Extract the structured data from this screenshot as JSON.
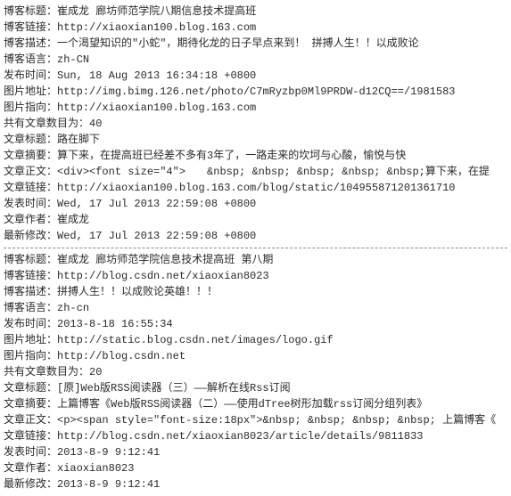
{
  "blocks": [
    {
      "fields": [
        {
          "label": "博客标题：",
          "value": "崔成龙 廊坊师范学院八期信息技术提高班"
        },
        {
          "label": "博客链接：",
          "value": "http://xiaoxian100.blog.163.com"
        },
        {
          "label": "博客描述：",
          "value": "一个渴望知识的\"小蛇\"，期待化龙的日子早点来到！ 拼搏人生！！以成败论"
        },
        {
          "label": "博客语言：",
          "value": "zh-CN"
        },
        {
          "label": "发布时间：",
          "value": "Sun, 18 Aug 2013 16:34:18 +0800"
        },
        {
          "label": "图片地址：",
          "value": "http://img.bimg.126.net/photo/C7mRyzbp0Ml9PRDW-d12CQ==/1981583"
        },
        {
          "label": "图片指向：",
          "value": "http://xiaoxian100.blog.163.com"
        },
        {
          "label": "共有文章数目为：",
          "value": "40"
        },
        {
          "label": "文章标题：",
          "value": "路在脚下"
        },
        {
          "label": "文章摘要：",
          "value": "算下来，在提高班已经差不多有3年了，一路走来的坎坷与心酸，愉悦与快"
        },
        {
          "label": "文章正文：",
          "value": "<div><font size=\"4\">　　&nbsp; &nbsp; &nbsp; &nbsp; &nbsp;算下来，在提"
        },
        {
          "label": "文章链接：",
          "value": "http://xiaoxian100.blog.163.com/blog/static/104955871201361710"
        },
        {
          "label": "发表时间：",
          "value": "Wed, 17 Jul 2013 22:59:08 +0800"
        },
        {
          "label": "文章作者：",
          "value": "崔成龙"
        },
        {
          "label": "最新修改：",
          "value": "Wed, 17 Jul 2013 22:59:08 +0800"
        }
      ]
    },
    {
      "fields": [
        {
          "label": "博客标题：",
          "value": "崔成龙 廊坊师范学院信息技术提高班 第八期"
        },
        {
          "label": "博客链接：",
          "value": "http://blog.csdn.net/xiaoxian8023"
        },
        {
          "label": "博客描述：",
          "value": "拼搏人生！！以成败论英雄！！！"
        },
        {
          "label": "博客语言：",
          "value": "zh-cn"
        },
        {
          "label": "发布时间：",
          "value": "2013-8-18 16:55:34"
        },
        {
          "label": "图片地址：",
          "value": "http://static.blog.csdn.net/images/logo.gif"
        },
        {
          "label": "图片指向：",
          "value": "http://blog.csdn.net"
        },
        {
          "label": "共有文章数目为：",
          "value": "20"
        },
        {
          "label": "文章标题：",
          "value": "[原]Web版RSS阅读器（三）——解析在线Rss订阅"
        },
        {
          "label": "文章摘要：",
          "value": "上篇博客《Web版RSS阅读器（二）——使用dTree树形加载rss订阅分组列表》"
        },
        {
          "label": "文章正文：",
          "value": "<p><span style=\"font-size:18px\">&nbsp; &nbsp; &nbsp; &nbsp; 上篇博客《"
        },
        {
          "label": "文章链接：",
          "value": "http://blog.csdn.net/xiaoxian8023/article/details/9811833"
        },
        {
          "label": "发表时间：",
          "value": "2013-8-9 9:12:41"
        },
        {
          "label": "文章作者：",
          "value": "xiaoxian8023"
        },
        {
          "label": "最新修改：",
          "value": "2013-8-9 9:12:41"
        }
      ]
    }
  ]
}
